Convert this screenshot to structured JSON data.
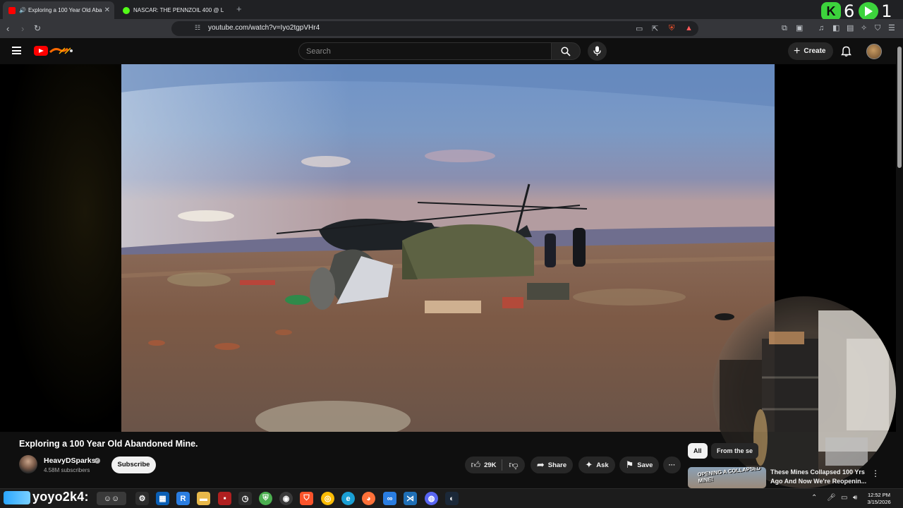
{
  "browser": {
    "tabs": [
      {
        "title": "Exploring a 100 Year Old Aba",
        "active": true,
        "audio": true
      },
      {
        "title": "NASCAR: THE PENNZOIL 400 @ L",
        "active": false
      }
    ],
    "new_tab": "+",
    "url": "youtube.com/watch?v=Iyo2tgpVHr4"
  },
  "overlay": {
    "first_count": "6",
    "first_badge": "K",
    "second_count": "1"
  },
  "youtube": {
    "search_placeholder": "Search",
    "create_label": "Create",
    "video": {
      "title": "Exploring a 100 Year Old Abandoned Mine.",
      "channel": "HeavyDSparks",
      "verified": true,
      "subscribers": "4.58M subscribers",
      "subscribe_label": "Subscribe",
      "likes": "29K",
      "share_label": "Share",
      "ask_label": "Ask",
      "save_label": "Save",
      "more": "···"
    },
    "sidebar": {
      "chips": [
        "All",
        "From the se"
      ],
      "recommendation": {
        "thumb_text": "OPENING A COLLAPSED MINE!",
        "title": "These Mines Collapsed 100 Yrs Ago And Now We're Reopenin..."
      }
    }
  },
  "taskbar": {
    "text": "yoyo2k4:",
    "time": "12:52 PM",
    "date": "3/15/2026"
  },
  "colors": {
    "yt_red": "#ff0000",
    "bg": "#0f0f0f",
    "chip_active": "#f1f1f1",
    "overlay_green": "#3cd33c"
  }
}
